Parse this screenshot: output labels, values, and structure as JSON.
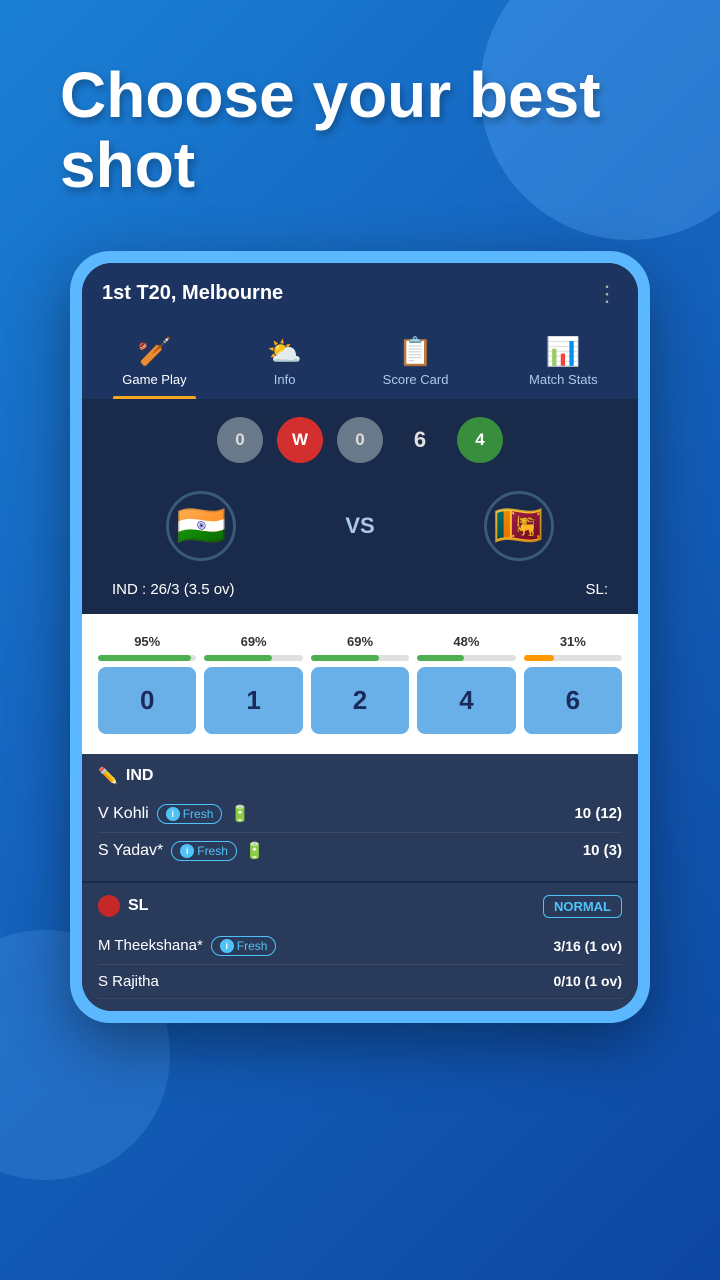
{
  "hero": {
    "title": "Choose your best shot"
  },
  "match": {
    "title": "1st T20, Melbourne"
  },
  "nav": {
    "tabs": [
      {
        "id": "game-play",
        "label": "Game Play",
        "icon": "🏏",
        "active": true
      },
      {
        "id": "info",
        "label": "Info",
        "icon": "⛅",
        "active": false
      },
      {
        "id": "score-card",
        "label": "Score Card",
        "icon": "📋",
        "active": false
      },
      {
        "id": "match-stats",
        "label": "Match Stats",
        "icon": "📊",
        "active": false
      }
    ]
  },
  "balls": [
    {
      "value": "0",
      "type": "grey"
    },
    {
      "value": "W",
      "type": "wicket"
    },
    {
      "value": "0",
      "type": "grey"
    },
    {
      "value": "6",
      "type": "number"
    },
    {
      "value": "4",
      "type": "green"
    }
  ],
  "teams": {
    "home": {
      "name": "IND",
      "flag": "🇮🇳",
      "score": "26/3",
      "overs": "3.5"
    },
    "away": {
      "name": "SL",
      "flag": "🇱🇰",
      "score": ""
    }
  },
  "shots": [
    {
      "value": "0",
      "pct": "95%",
      "bar_width": "95",
      "bar_type": "green"
    },
    {
      "value": "1",
      "pct": "69%",
      "bar_width": "69",
      "bar_type": "green"
    },
    {
      "value": "2",
      "pct": "69%",
      "bar_width": "69",
      "bar_type": "green"
    },
    {
      "value": "4",
      "pct": "48%",
      "bar_width": "48",
      "bar_type": "green"
    },
    {
      "value": "6",
      "pct": "31%",
      "bar_width": "31",
      "bar_type": "orange"
    }
  ],
  "batting_team": {
    "name": "IND",
    "icon": "✏️",
    "players": [
      {
        "name": "V Kohli",
        "fresh": true,
        "score": "10 (12)"
      },
      {
        "name": "S Yadav*",
        "fresh": true,
        "score": "10 (3)"
      }
    ]
  },
  "bowling_team": {
    "name": "SL",
    "mode": "NORMAL",
    "bowlers": [
      {
        "name": "M Theekshana*",
        "fresh": true,
        "score": "3/16 (1 ov)"
      },
      {
        "name": "S Rajitha",
        "fresh": false,
        "score": "0/10 (1 ov)"
      }
    ]
  }
}
